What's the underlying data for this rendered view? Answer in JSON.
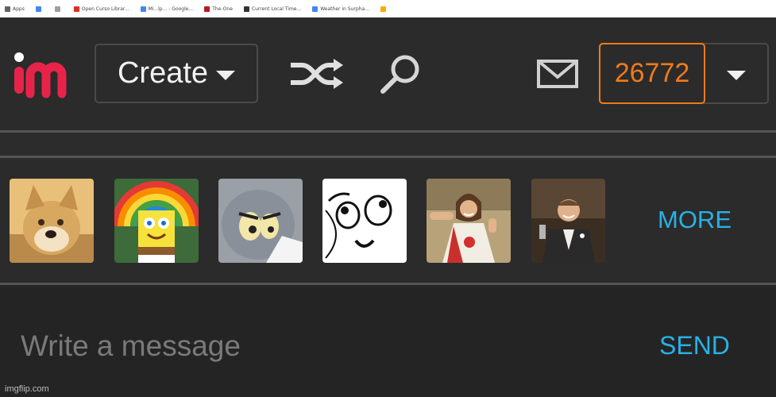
{
  "bookmarks": [
    {
      "label": "Apps",
      "icon": "apps-icon",
      "color": "#5f6368"
    },
    {
      "label": "",
      "icon": "google-icon",
      "color": "#4285f4"
    },
    {
      "label": "",
      "icon": "page-icon",
      "color": "#9aa0a6"
    },
    {
      "label": "Open Curso Librar...",
      "icon": "bookmark-icon",
      "color": "#d93025"
    },
    {
      "label": "Mi...lp... - Google...",
      "icon": "google-icon",
      "color": "#4285f4"
    },
    {
      "label": "The-One",
      "icon": "bookmark-icon",
      "color": "#b71c1c"
    },
    {
      "label": "Current Local Time...",
      "icon": "clock-icon",
      "color": "#333333"
    },
    {
      "label": "Weather in Surpha...",
      "icon": "google-icon",
      "color": "#4285f4"
    },
    {
      "label": "",
      "icon": "bookmark-icon",
      "color": "#f9ab00"
    }
  ],
  "header": {
    "logo_alt": "imgflip logo",
    "create_label": "Create",
    "points": "26772"
  },
  "meme_tray": {
    "items": [
      {
        "name": "doge-meme-thumb",
        "icon": "doge-image"
      },
      {
        "name": "spongebob-imagination-meme-thumb",
        "icon": "spongebob-image"
      },
      {
        "name": "unsettled-tom-meme-thumb",
        "icon": "tom-image"
      },
      {
        "name": "derp-face-meme-thumb",
        "icon": "derp-image"
      },
      {
        "name": "buddy-christ-meme-thumb",
        "icon": "buddy-christ-image"
      },
      {
        "name": "laughing-leo-meme-thumb",
        "icon": "leo-image"
      }
    ],
    "more_label": "MORE"
  },
  "compose": {
    "placeholder": "Write a message",
    "send_label": "SEND"
  },
  "watermark": "imgflip.com",
  "colors": {
    "accent_orange": "#f07a1a",
    "link_blue": "#28b1e6",
    "logo_red": "#e8234a"
  }
}
